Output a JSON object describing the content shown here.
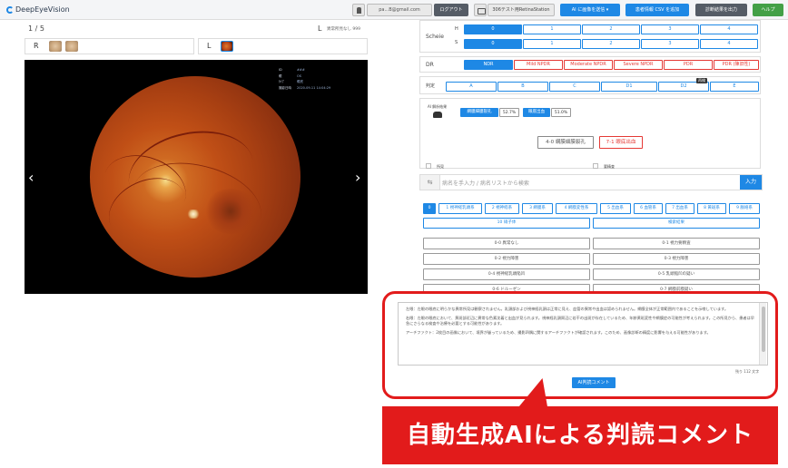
{
  "app": {
    "title": "DeepEyeVision"
  },
  "header": {
    "user_email": "pa...B@gmail.com",
    "logout": "ログアウト",
    "station": "306テスト用RetinaStation",
    "ai_request": "AI に画像を送信 ▾",
    "patient_csv": "患者情報 CSV を追加",
    "download_results": "診断結果を出力",
    "help": "ヘルプ"
  },
  "viewer": {
    "counter": "1 / 5",
    "eye_side": "L",
    "no_issue": "異常所見なし 999",
    "right_label": "R",
    "left_label": "L",
    "meta": [
      {
        "k": "ID",
        "v": "###"
      },
      {
        "k": "眼",
        "v": "OS"
      },
      {
        "k": "ﾀｲﾌﾟ",
        "v": "眼底"
      },
      {
        "k": "撮影日時",
        "v": "2020-09-11 14:04:29"
      }
    ],
    "prev": "‹",
    "next": "›"
  },
  "grading": {
    "scheie_label": "Scheie",
    "h_label": "H",
    "s_label": "S",
    "scheie_options": [
      "0",
      "1",
      "2",
      "3",
      "4"
    ],
    "dr_label": "DR",
    "dr_options": [
      "NDR",
      "Mild NPDR",
      "Moderate NPDR",
      "Severe NPDR",
      "PDR",
      "PDR (陳旧性)"
    ],
    "judge_label": "判定",
    "judge_options": [
      "A",
      "B",
      "C",
      "D1",
      "D2",
      "E"
    ],
    "judge_tag": "再検"
  },
  "ai_result": {
    "label": "AI 解析結果",
    "finding1": "網膜細膜裂孔",
    "finding1_val": "52.7%",
    "finding2": "眼底出血",
    "finding2_val": "51.0%",
    "suggest1": "4-0 網膜細膜裂孔",
    "suggest2": "7-1 眼底出血",
    "left_sub": "所見",
    "right_sub": "要精査"
  },
  "search": {
    "icon": "⇆",
    "placeholder": "病名を手入力 / 病名リストから検索",
    "submit": "入力"
  },
  "category_tabs": [
    "0",
    "1 視神経乳頭系",
    "2 視神経系",
    "3 網膜系",
    "4 網膜変性系",
    "5 出血系",
    "6 血管系",
    "7 出血系",
    "8 黄斑系",
    "9 脈絡系"
  ],
  "sub_tabs": [
    "10 硝子体",
    "検索結果"
  ],
  "options_left": [
    "0-0 異常なし",
    "0-2 視力障害",
    "0-4 視神経乳頭陥凹",
    "0-6 ドルーゼン"
  ],
  "options_right": [
    "0-1 視力要精査",
    "0-3 視力障害",
    "0-5 乳頭陥凹の疑い",
    "0-7 網膜前膜疑い"
  ],
  "comment": {
    "paragraphs": [
      "左眼：左眼の眼底に明らかな異常所見は観察されません。乳頭部および視神経乳頭は正常に見え、血管の異常や出血は認められません。網膜全体が正常範囲内であることを示唆しています。",
      "右眼：左眼の眼底において、黄斑部近辺に異常な色素沈着と出血が見られます。視神経乳頭周辺に若干の出斑が存在しているため、年齢黄斑変性や網膜症の可能性が考えられます。この所見から、患者は早急にさらなる検査や治療を必要とする可能性があります。",
      "アーチファクト：2枚目の画像において、境界が曇っているため、撮影四隅に関するアーチファクトが確認されます。このため、画像診断の精度に影響を与える可能性があります。"
    ],
    "count": "残り 112 文字",
    "button": "AI判読コメント"
  },
  "banner": {
    "text": "自動生成AIによる判読コメント"
  },
  "colors": {
    "accent": "#1e88e5",
    "highlight": "#e21b1b",
    "dark_button": "#555c66",
    "help": "#43a047"
  }
}
